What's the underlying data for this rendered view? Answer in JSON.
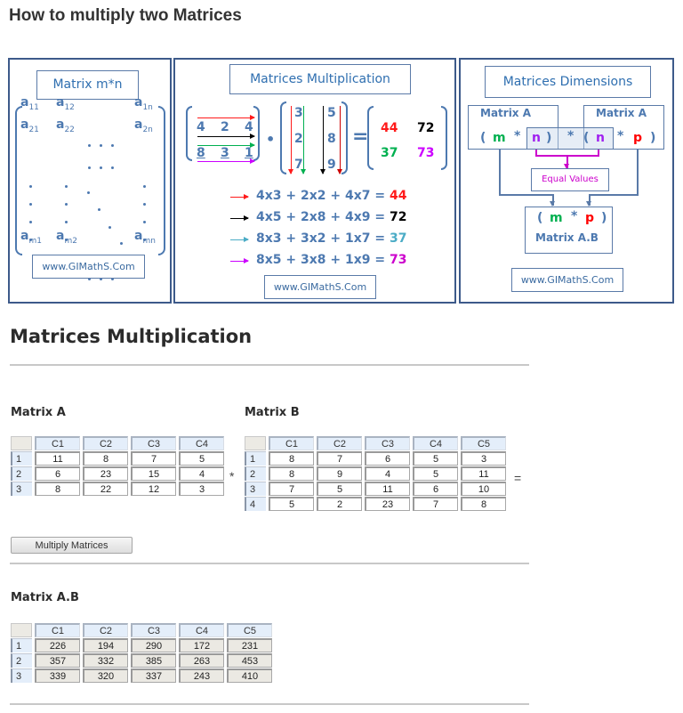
{
  "page": {
    "title": "How to multiply two Matrices"
  },
  "infographic": {
    "panel1": {
      "title": "Matrix m*n",
      "elements": {
        "r1": [
          {
            "a": "a",
            "sub": "11"
          },
          {
            "a": "a",
            "sub": "12"
          },
          {
            "a": "a",
            "sub": "1n"
          }
        ],
        "r2": [
          {
            "a": "a",
            "sub": "21"
          },
          {
            "a": "a",
            "sub": "22"
          },
          {
            "a": "a",
            "sub": "2n"
          }
        ],
        "rm": [
          {
            "a": "a",
            "sub": "m1"
          },
          {
            "a": "a",
            "sub": "m2"
          },
          {
            "a": "a",
            "sub": "mn"
          }
        ]
      },
      "website": "www.GIMathS.Com"
    },
    "panel2": {
      "title": "Matrices Multiplication",
      "matrix_a": [
        [
          "4",
          "2",
          "4"
        ],
        [
          "8",
          "3",
          "1"
        ]
      ],
      "matrix_b": [
        [
          "3",
          "5"
        ],
        [
          "2",
          "8"
        ],
        [
          "7",
          "9"
        ]
      ],
      "dot": "•",
      "equals": "=",
      "result": [
        [
          "44",
          "72"
        ],
        [
          "37",
          "73"
        ]
      ],
      "equations": [
        {
          "expr": "4x3 + 2x2 + 4x7 = ",
          "result": "44",
          "color": "#ff1a1a"
        },
        {
          "expr": "4x5 + 2x8 + 4x9 = ",
          "result": "72",
          "color": "#000000"
        },
        {
          "expr": "8x3 + 3x2 + 1x7 = ",
          "result": "37",
          "color": "#4bacc6"
        },
        {
          "expr": "8x5 + 3x8 + 1x9 = ",
          "result": "73",
          "color": "#cc00cc"
        }
      ],
      "colors": {
        "red": "#ff1a1a",
        "black": "#000000",
        "green": "#00b050",
        "magenta": "#cc00ff",
        "cyan": "#4bacc6"
      },
      "website": "www.GIMathS.Com"
    },
    "panel3": {
      "title": "Matrices Dimensions",
      "left_label": "Matrix A",
      "right_label": "Matrix A",
      "open": "(",
      "close": ")",
      "star": "*",
      "m": "m",
      "n": "n",
      "p": "p",
      "equal_values": "Equal Values",
      "result_label": "Matrix A.B",
      "website": "www.GIMathS.Com"
    }
  },
  "calculator": {
    "section_title": "Matrices Multiplication",
    "matrix_a": {
      "label": "Matrix A",
      "columns": [
        "C1",
        "C2",
        "C3",
        "C4"
      ],
      "rows": [
        {
          "index": "1",
          "values": [
            "11",
            "8",
            "7",
            "5"
          ]
        },
        {
          "index": "2",
          "values": [
            "6",
            "23",
            "15",
            "4"
          ]
        },
        {
          "index": "3",
          "values": [
            "8",
            "22",
            "12",
            "3"
          ]
        }
      ]
    },
    "times_sign": "*",
    "matrix_b": {
      "label": "Matrix B",
      "columns": [
        "C1",
        "C2",
        "C3",
        "C4",
        "C5"
      ],
      "rows": [
        {
          "index": "1",
          "values": [
            "8",
            "7",
            "6",
            "5",
            "3"
          ]
        },
        {
          "index": "2",
          "values": [
            "8",
            "9",
            "4",
            "5",
            "11"
          ]
        },
        {
          "index": "3",
          "values": [
            "7",
            "5",
            "11",
            "6",
            "10"
          ]
        },
        {
          "index": "4",
          "values": [
            "5",
            "2",
            "23",
            "7",
            "8"
          ]
        }
      ]
    },
    "equals_sign": "=",
    "multiply_button": "Multiply Matrices",
    "result": {
      "label": "Matrix A.B",
      "columns": [
        "C1",
        "C2",
        "C3",
        "C4",
        "C5"
      ],
      "rows": [
        {
          "index": "1",
          "values": [
            "226",
            "194",
            "290",
            "172",
            "231"
          ]
        },
        {
          "index": "2",
          "values": [
            "357",
            "332",
            "385",
            "263",
            "453"
          ]
        },
        {
          "index": "3",
          "values": [
            "339",
            "320",
            "337",
            "243",
            "410"
          ]
        }
      ]
    }
  }
}
